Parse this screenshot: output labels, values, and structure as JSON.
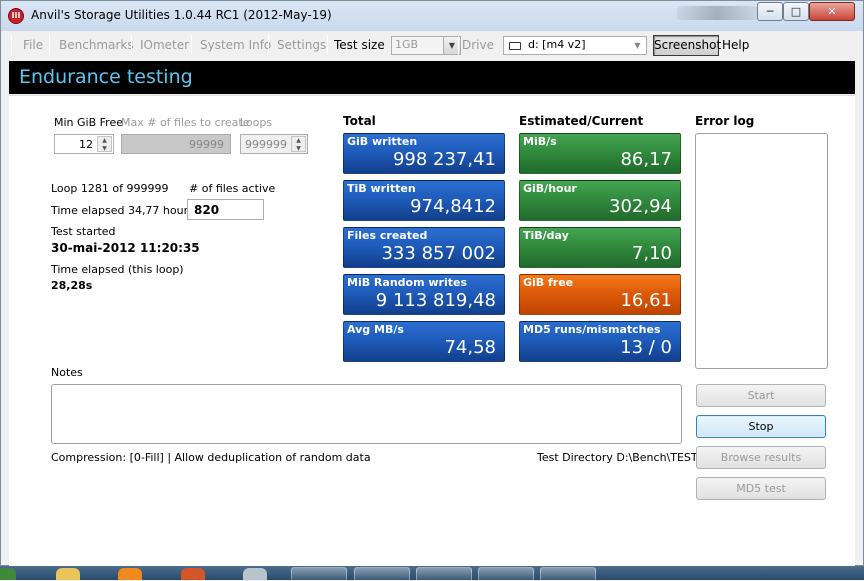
{
  "window": {
    "title": "Anvil's Storage Utilities 1.0.44 RC1 (2012-May-19)",
    "caption_buttons": [
      "minimize",
      "maximize",
      "close"
    ],
    "icon_label": "III"
  },
  "menu": {
    "items": [
      {
        "label": "File",
        "enabled": false
      },
      {
        "label": "Benchmarks",
        "enabled": false
      },
      {
        "label": "IOmeter",
        "enabled": false
      },
      {
        "label": "System Info",
        "enabled": false
      },
      {
        "label": "Settings",
        "enabled": false
      }
    ],
    "test_size_label": "Test size",
    "test_size_value": "1GB",
    "drive_label": "Drive",
    "drive_value": "d: [m4 v2]",
    "screenshot_label": "Screenshot",
    "help_label": "Help"
  },
  "header": {
    "title": "Endurance testing"
  },
  "params": {
    "min_gib_free_label": "Min GiB Free",
    "min_gib_free_value": "12",
    "max_files_label": "Max # of files to create",
    "max_files_value": "99999",
    "loops_label": "Loops",
    "loops_value": "999999"
  },
  "status": {
    "loop": "Loop 1281 of 999999",
    "files_active_label": "# of files active",
    "files_active_value": "820",
    "time_elapsed": "Time elapsed 34,77 hours",
    "test_started_label": "Test started",
    "test_started_value": "30-mai-2012 11:20:35",
    "time_elapsed_loop_label": "Time elapsed (this loop)",
    "time_elapsed_loop_value": "28,28s"
  },
  "total": {
    "heading": "Total",
    "tiles": [
      {
        "title": "GiB written",
        "value": "998 237,41"
      },
      {
        "title": "TiB written",
        "value": "974,8412"
      },
      {
        "title": "Files created",
        "value": "333 857 002"
      },
      {
        "title": "MiB Random writes",
        "value": "9 113 819,48"
      },
      {
        "title": "Avg MB/s",
        "value": "74,58"
      }
    ]
  },
  "estimated": {
    "heading": "Estimated/Current",
    "tiles": [
      {
        "title": "MiB/s",
        "value": "86,17"
      },
      {
        "title": "GiB/hour",
        "value": "302,94"
      },
      {
        "title": "TiB/day",
        "value": "7,10"
      },
      {
        "title": "GiB free",
        "value": "16,61"
      },
      {
        "title": "MD5 runs/mismatches",
        "value": "13 / 0"
      }
    ]
  },
  "colors": {
    "tile_blue": "#1f5cbb",
    "tile_green": "#318b3e",
    "tile_orange": "#de5b0a",
    "header_bg": "#000000",
    "header_text": "#5cc7f0"
  },
  "error_log": {
    "heading": "Error log"
  },
  "notes": {
    "label": "Notes"
  },
  "footer": {
    "compression": "Compression: [0-Fill]  |  Allow deduplication of random data",
    "test_directory": "Test Directory D:\\Bench\\TEST"
  },
  "actions": {
    "start": "Start",
    "stop": "Stop",
    "browse": "Browse results",
    "md5": "MD5 test"
  }
}
